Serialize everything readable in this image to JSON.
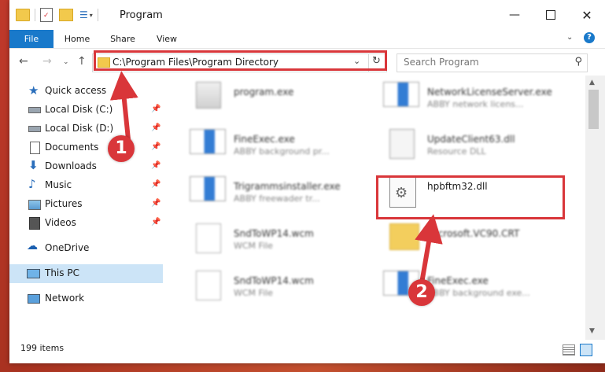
{
  "window": {
    "title": "Program"
  },
  "ribbon": {
    "tabs": [
      "File",
      "Home",
      "Share",
      "View"
    ]
  },
  "address": {
    "path": "C:\\Program Files\\Program Directory"
  },
  "search": {
    "placeholder": "Search Program"
  },
  "sidebar": {
    "items": [
      {
        "label": "Quick access",
        "icon": "star-icon"
      },
      {
        "label": "Local Disk (C:)",
        "icon": "drive-icon"
      },
      {
        "label": "Local Disk (D:)",
        "icon": "drive-icon"
      },
      {
        "label": "Documents",
        "icon": "document-icon"
      },
      {
        "label": "Downloads",
        "icon": "download-icon"
      },
      {
        "label": "Music",
        "icon": "music-icon"
      },
      {
        "label": "Pictures",
        "icon": "picture-icon"
      },
      {
        "label": "Videos",
        "icon": "video-icon"
      },
      {
        "label": "OneDrive",
        "icon": "cloud-icon"
      },
      {
        "label": "This PC",
        "icon": "computer-icon"
      },
      {
        "label": "Network",
        "icon": "network-icon"
      }
    ]
  },
  "files": [
    {
      "name": "program.exe",
      "desc": ""
    },
    {
      "name": "NetworkLicenseServer.exe",
      "desc": "ABBY network licens..."
    },
    {
      "name": "FineExec.exe",
      "desc": "ABBY background pr..."
    },
    {
      "name": "UpdateClient63.dll",
      "desc": "Resource DLL"
    },
    {
      "name": "Trigrammsinstaller.exe",
      "desc": "ABBY freewader tr..."
    },
    {
      "name": "hpbftm32.dll",
      "desc": ""
    },
    {
      "name": "SndToWP14.wcm",
      "desc": "WCM File"
    },
    {
      "name": "Microsoft.VC90.CRT",
      "desc": ""
    },
    {
      "name": "SndToWP14.wcm",
      "desc": "WCM File"
    },
    {
      "name": "FineExec.exe",
      "desc": "ABBY background exe..."
    }
  ],
  "status": {
    "items_count": "199 items"
  },
  "callouts": {
    "one": "1",
    "two": "2"
  },
  "colors": {
    "accent": "#1979ca",
    "highlight": "#d9363a",
    "selection": "#cce4f7"
  }
}
